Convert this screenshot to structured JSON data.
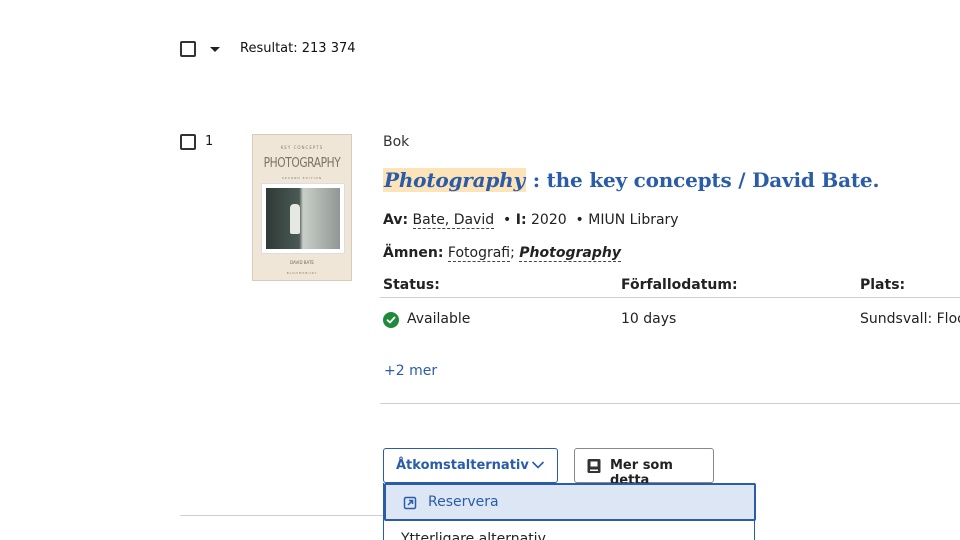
{
  "results": {
    "label": "Resultat: 213 374"
  },
  "record": {
    "number": "1",
    "format": "Bok",
    "title_highlight": "Photography",
    "title_rest": " : the key concepts / David Bate.",
    "author_label": "Av:",
    "author": "Bate, David",
    "year_label": "I:",
    "year": "2020",
    "library": "MIUN Library",
    "subjects_label": "Ämnen:",
    "subject1": "Fotografi",
    "subject2": "Photography",
    "cover": {
      "top_text": "KEY CONCEPTS",
      "title": "PHOTOGRAPHY",
      "subtitle": "SECOND EDITION",
      "author": "DAVID BATE",
      "publisher": "BLOOMSBURY"
    }
  },
  "holdings": {
    "headers": {
      "status": "Status:",
      "due": "Förfallodatum:",
      "location": "Plats:"
    },
    "row": {
      "status": "Available",
      "due": "10 days",
      "location": "Sundsvall: Floor"
    },
    "more": "+2 mer"
  },
  "actions": {
    "access_label": "Åtkomstalternativ",
    "more_like_this": "Mer som detta",
    "dropdown": {
      "reserve": "Reservera",
      "further": "Ytterligare alternativ"
    }
  },
  "colors": {
    "link": "#2a5caa",
    "highlight": "#fde3b8",
    "available": "#1f8a3c"
  }
}
